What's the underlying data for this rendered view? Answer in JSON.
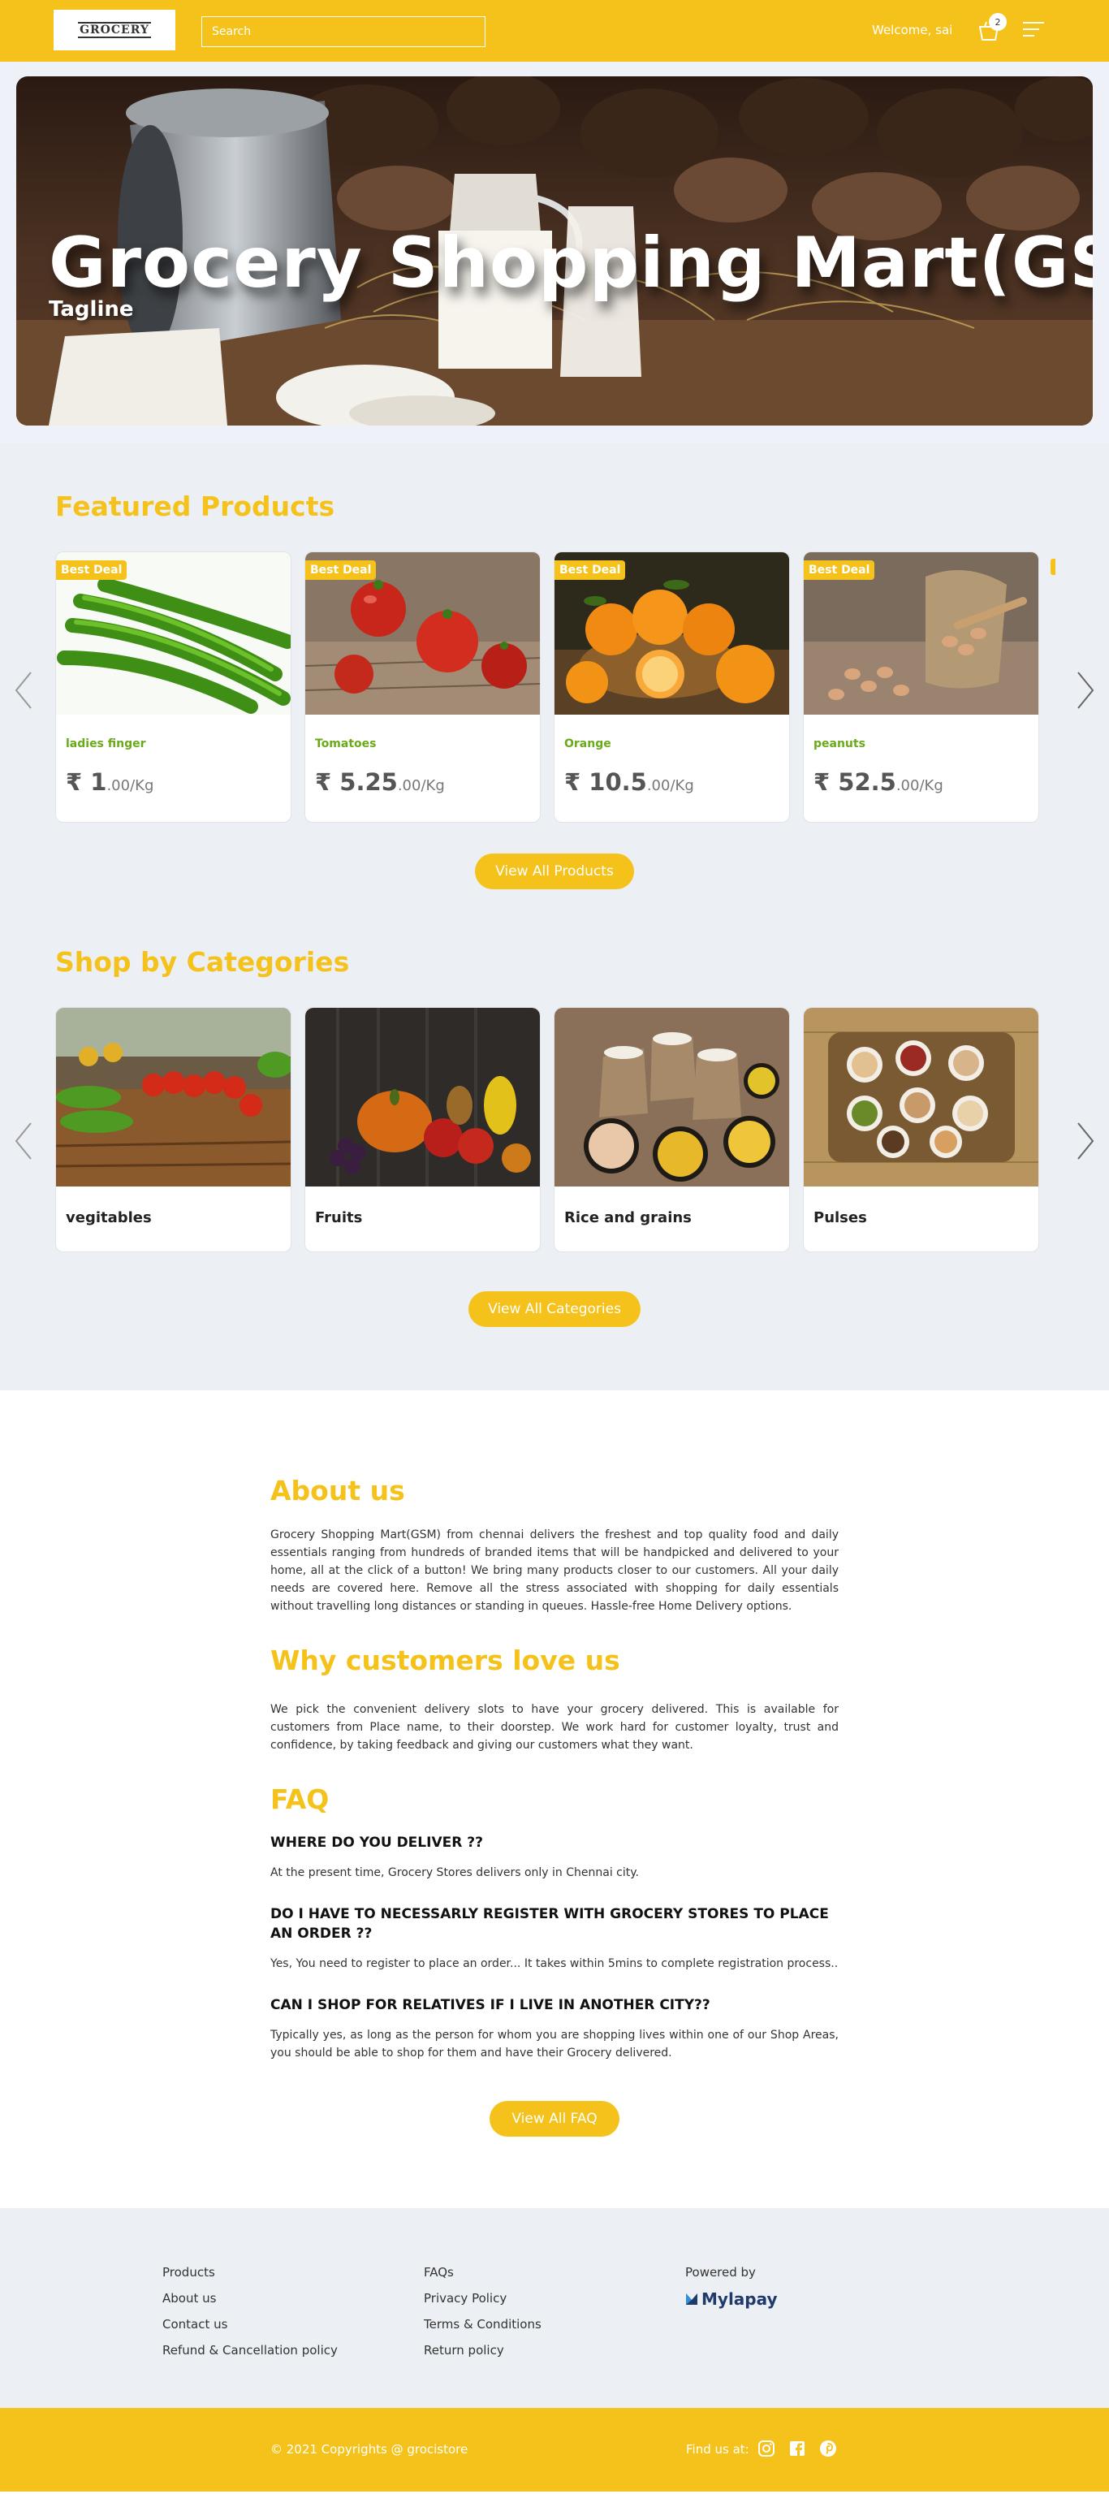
{
  "header": {
    "logo_text": "GROCERY",
    "search_placeholder": "Search",
    "welcome": "Welcome, sai",
    "cart_count": "2"
  },
  "hero": {
    "title": "Grocery Shopping Mart(GSM)",
    "tagline": "Tagline"
  },
  "featured": {
    "title": "Featured Products",
    "badge": "Best Deal",
    "products": [
      {
        "name": "ladies finger",
        "price_main": "₹ 1",
        "price_unit": ".00/Kg"
      },
      {
        "name": "Tomatoes",
        "price_main": "₹ 5.25",
        "price_unit": ".00/Kg"
      },
      {
        "name": "Orange",
        "price_main": "₹ 10.5",
        "price_unit": ".00/Kg"
      },
      {
        "name": "peanuts",
        "price_main": "₹ 52.5",
        "price_unit": ".00/Kg"
      }
    ],
    "view_all": "View All Products"
  },
  "categories": {
    "title": "Shop by Categories",
    "items": [
      {
        "name": "vegitables"
      },
      {
        "name": "Fruits"
      },
      {
        "name": "Rice and grains"
      },
      {
        "name": "Pulses"
      }
    ],
    "view_all": "View All Categories"
  },
  "about": {
    "title": "About us",
    "text": "Grocery Shopping Mart(GSM) from chennai delivers the freshest and top quality food and daily essentials ranging from hundreds of branded items that will be handpicked and delivered to your home, all at the click of a button! We bring many products closer to our customers. All your daily needs are covered here. Remove all the stress associated with shopping for daily essentials without travelling long distances or standing in queues. Hassle-free Home Delivery options."
  },
  "why": {
    "title": "Why customers love us",
    "text": "We pick the convenient delivery slots to have your grocery delivered. This is available for customers from Place name, to their doorstep. We work hard for customer loyalty, trust and confidence, by taking feedback and giving our customers what they want."
  },
  "faq": {
    "title": "FAQ",
    "items": [
      {
        "q": "WHERE DO YOU DELIVER ??",
        "a": "At the present time, Grocery Stores delivers only in Chennai city."
      },
      {
        "q": "DO I HAVE TO NECESSARLY REGISTER WITH GROCERY STORES TO PLACE AN ORDER ??",
        "a": "Yes, You need to register to place an order... It takes within 5mins to complete registration process.."
      },
      {
        "q": "CAN I SHOP FOR RELATIVES IF I LIVE IN ANOTHER CITY??",
        "a": "Typically yes, as long as the person for whom you are shopping lives within one of our Shop Areas, you should be able to shop for them and have their Grocery delivered."
      }
    ],
    "view_all": "View All FAQ"
  },
  "footer": {
    "col1": [
      "Products",
      "About us",
      "Contact us",
      "Refund & Cancellation policy"
    ],
    "col2": [
      "FAQs",
      "Privacy Policy",
      "Terms & Conditions",
      "Return policy"
    ],
    "powered_by": "Powered by",
    "brand": "Mylapay",
    "copyright": "© 2021 Copyrights @ grocistore",
    "find_us": "Find us at:",
    "social_icons": [
      "instagram-icon",
      "facebook-icon",
      "pinterest-icon"
    ]
  },
  "colors": {
    "accent": "#f5c21b",
    "green_label": "#6aaa1a",
    "grey_bg": "#eceff3"
  }
}
